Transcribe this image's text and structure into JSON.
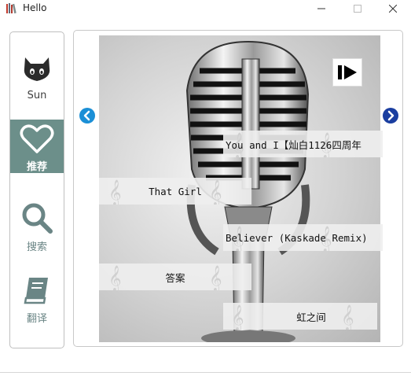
{
  "window": {
    "title": "Hello"
  },
  "sidebar": {
    "items": [
      {
        "label": "Sun"
      },
      {
        "label": "推荐"
      },
      {
        "label": "搜索"
      },
      {
        "label": "翻译"
      }
    ],
    "selected_index": 1,
    "colors": {
      "accent": "#6c8f8a",
      "icon": "#6a8585"
    }
  },
  "songs": [
    {
      "title": "You and I【灿白1126四周年"
    },
    {
      "title": "That Girl"
    },
    {
      "title": "Believer (Kaskade Remix)"
    },
    {
      "title": "答案"
    },
    {
      "title": "虹之间"
    }
  ],
  "controls": {
    "play_icon": "play-pause-icon",
    "prev_icon": "chevron-left-icon",
    "next_icon": "chevron-right-icon"
  }
}
